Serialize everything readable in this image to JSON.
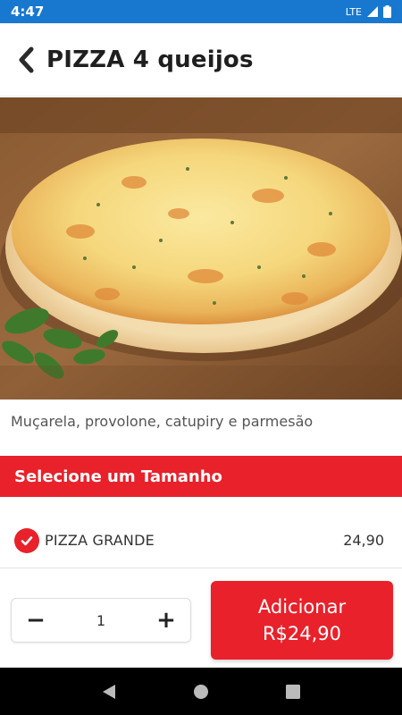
{
  "status_bar": {
    "time": "4:47",
    "network": "LTE"
  },
  "header": {
    "title": "PIZZA 4 queijos",
    "back_icon": "chevron-left-icon"
  },
  "product": {
    "image": "pizza-4-queijos-photo",
    "description": "Muçarela, provolone, catupiry e parmesão"
  },
  "size_section": {
    "title": "Selecione um Tamanho",
    "options": [
      {
        "name": "PIZZA GRANDE",
        "price": "24,90",
        "selected": true
      }
    ]
  },
  "footer": {
    "quantity": "1",
    "decrement": "−",
    "increment": "+",
    "add_label": "Adicionar",
    "add_price": "R$24,90"
  },
  "colors": {
    "accent": "#e8212b",
    "status_bar": "#1878cf"
  }
}
